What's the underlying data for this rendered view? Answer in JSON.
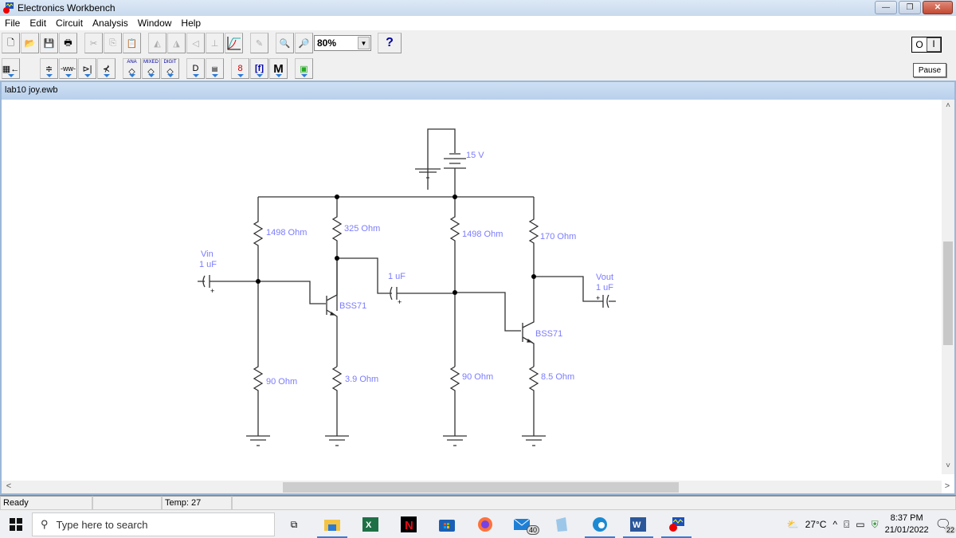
{
  "window": {
    "title": "Electronics Workbench",
    "controls": [
      "minimize",
      "restore",
      "close"
    ]
  },
  "menu": [
    "File",
    "Edit",
    "Circuit",
    "Analysis",
    "Window",
    "Help"
  ],
  "toolbar1": {
    "buttons": [
      "new",
      "open",
      "save",
      "print",
      "cut",
      "copy",
      "paste",
      "rotate",
      "flip-horizontal",
      "flip-vertical",
      "create-subcircuit",
      "graph",
      "component-properties",
      "zoom-out",
      "zoom-in"
    ],
    "zoom_value": "80%",
    "help_label": "?"
  },
  "toolbar2": {
    "buttons": [
      "favorites",
      "sources",
      "basic",
      "diodes",
      "transistors",
      "analog-ics",
      "mixed-ics",
      "digital-ics",
      "logic-gates",
      "digital",
      "indicators",
      "controls",
      "miscellaneous",
      "instruments"
    ],
    "labels": {
      "ana": "ANA",
      "mixed": "MIXED",
      "digit": "DIGIT",
      "misc": "M"
    }
  },
  "power": {
    "off": "O",
    "on": "I"
  },
  "pause_label": "Pause",
  "document": {
    "title": "lab10 joy.ewb"
  },
  "circuit": {
    "battery": "15 V",
    "resistors": {
      "r1": "1498  Ohm",
      "r2": "325  Ohm",
      "r3": "1498  Ohm",
      "r4": "170  Ohm",
      "r5": "90  Ohm",
      "r6": "3.9  Ohm",
      "r7": "90  Ohm",
      "r8": "8.5  Ohm"
    },
    "vin_label": "Vin",
    "vin_cap": "1 uF",
    "coupling_cap": "1 uF",
    "vout_label": "Vout",
    "vout_cap": "1 uF",
    "q1": "BSS71",
    "q2": "BSS71",
    "label_color": "#7b7bff"
  },
  "status": {
    "ready": "Ready",
    "cell2": "",
    "temp": "Temp:  27",
    "cell4": ""
  },
  "taskbar": {
    "search_placeholder": "Type here to search",
    "apps": [
      "task-view",
      "file-explorer",
      "excel",
      "netflix",
      "store",
      "firefox",
      "mail",
      "notepad",
      "edge",
      "word",
      "electronics-workbench"
    ],
    "mail_badge": "40",
    "weather": "27°C",
    "time": "8:37 PM",
    "date": "21/01/2022",
    "notifications": "22"
  }
}
